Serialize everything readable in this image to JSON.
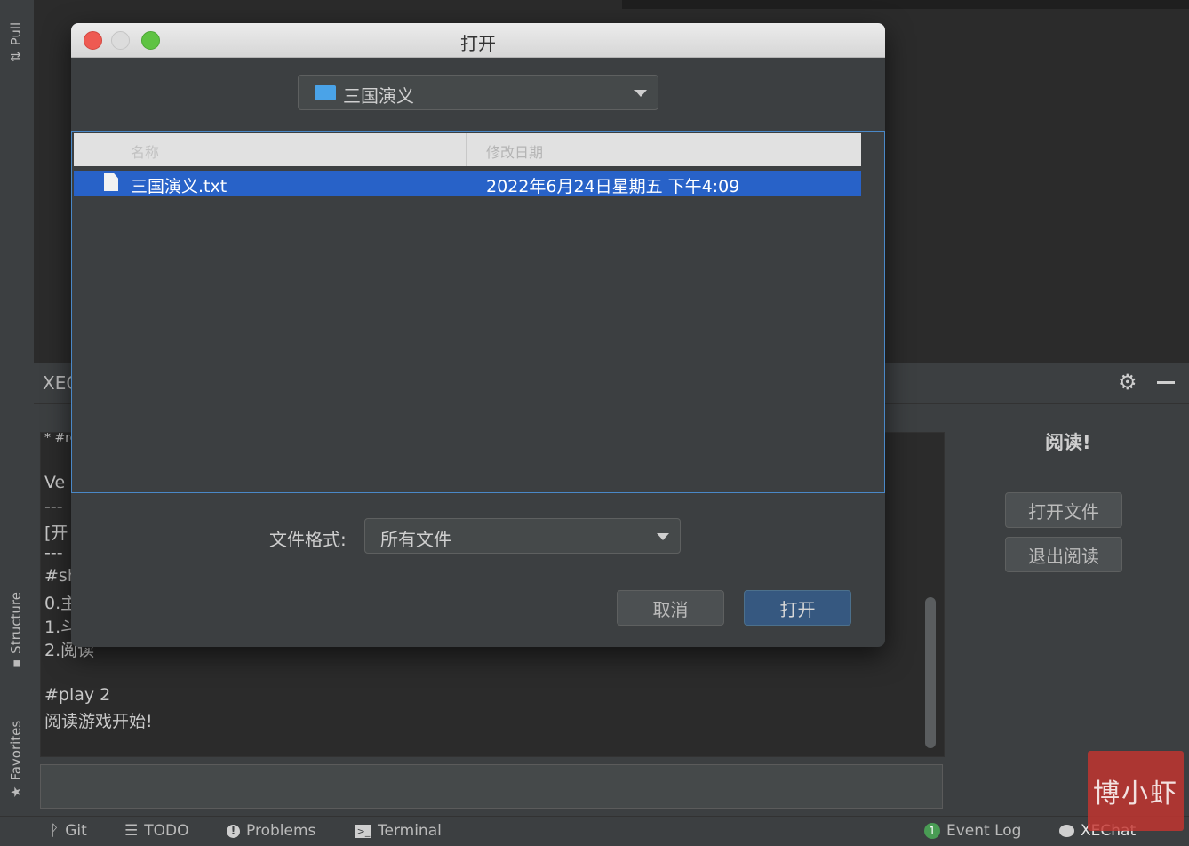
{
  "left_strip": {
    "pull_requests": "Pull",
    "structure": "Structure",
    "favorites": "Favorites"
  },
  "tool_window": {
    "title": "XEChat",
    "side_heading": "阅读!",
    "open_file_button": "打开文件",
    "exit_reading_button": "退出阅读"
  },
  "console": {
    "lines": [
      "* #re",
      "Ve",
      "---",
      "[开",
      "---",
      "#sh",
      "0.主",
      "1.斗",
      "2.阅读",
      "#play 2",
      "阅读游戏开始!"
    ]
  },
  "dialog": {
    "title": "打开",
    "folder": "三国演义",
    "columns": {
      "name": "名称",
      "modified": "修改日期"
    },
    "files": [
      {
        "name": "三国演义.txt",
        "modified": "2022年6月24日星期五 下午4:09"
      }
    ],
    "format_label": "文件格式:",
    "format_value": "所有文件",
    "cancel": "取消",
    "open": "打开"
  },
  "status_bar": {
    "git": "Git",
    "todo": "TODO",
    "problems": "Problems",
    "terminal": "Terminal",
    "event_log": "Event Log",
    "event_count": "1",
    "xechat": "XEChat"
  },
  "watermark_text": "博小虾",
  "colors": {
    "selection": "#2862c8",
    "primary_button": "#365880",
    "focus_border": "#4a88c7",
    "event_badge": "#499c54"
  }
}
